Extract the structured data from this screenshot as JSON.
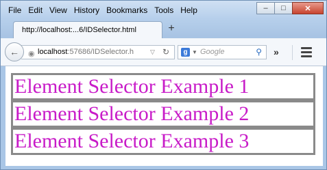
{
  "menu": {
    "items": [
      "File",
      "Edit",
      "View",
      "History",
      "Bookmarks",
      "Tools",
      "Help"
    ]
  },
  "window_controls": {
    "minimize": "–",
    "maximize": "□",
    "close": "✕"
  },
  "tab": {
    "title": "http://localhost:...6/IDSelector.html",
    "new_tab": "+"
  },
  "navbar": {
    "url_host": "localhost",
    "url_path": ":57686/IDSelector.h",
    "search_engine_letter": "g",
    "search_placeholder": "Google"
  },
  "content": {
    "items": [
      "Element Selector Example 1",
      "Element Selector Example 2",
      "Element Selector Example 3"
    ],
    "text_color": "#c81bc8"
  }
}
